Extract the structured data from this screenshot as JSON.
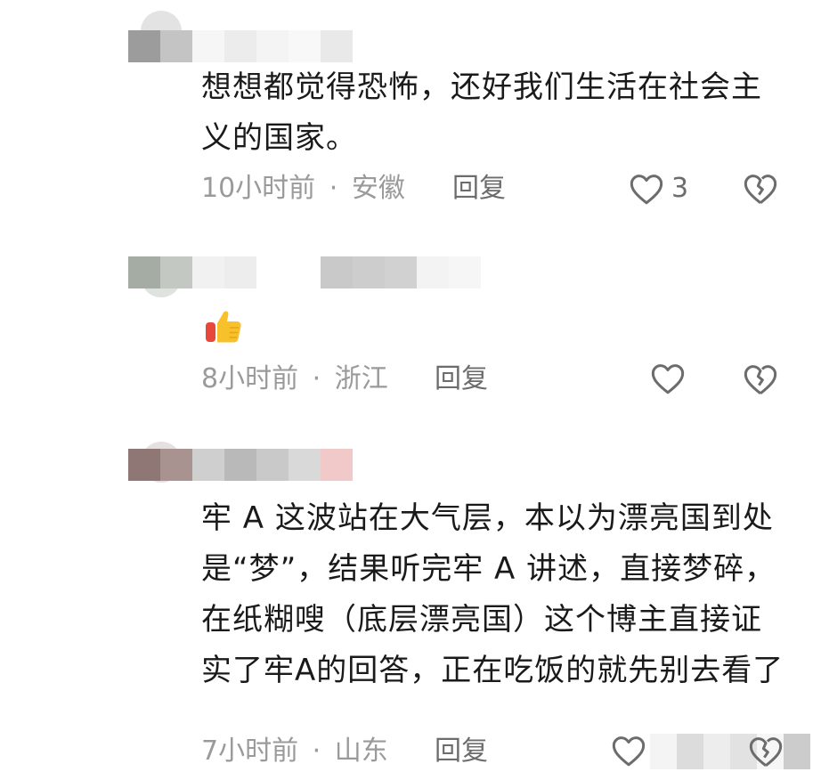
{
  "comments": [
    {
      "text": "想想都觉得恐怖，还好我们生活在社会主义的国家。",
      "time": "10小时前",
      "separator": "·",
      "location": "安徽",
      "reply_label": "回复",
      "like_count": "3"
    },
    {
      "text": "",
      "time": "8小时前",
      "separator": "·",
      "location": "浙江",
      "reply_label": "回复",
      "like_count": ""
    },
    {
      "text": "牢 A 这波站在大气层，本以为漂亮国到处是“梦”，结果听完牢 A 讲述，直接梦碎，在纸糊嗖（底层漂亮国）这个博主直接证实了牢A的回答，正在吃饭的就先别去看了",
      "time": "7小时前",
      "separator": "·",
      "location": "山东",
      "reply_label": "回复",
      "like_count": ""
    }
  ],
  "icons": {
    "like": "heart-outline-icon",
    "dislike": "broken-heart-icon",
    "emoji": "thumbs-up-emoji"
  },
  "colors": {
    "text": "#1a1a1a",
    "meta": "#9a9a9a",
    "action": "#6c6c6c"
  }
}
